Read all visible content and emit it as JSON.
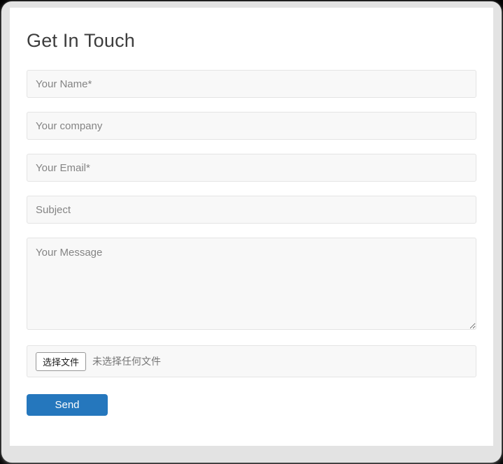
{
  "page": {
    "title": "Get In Touch"
  },
  "form": {
    "fields": [
      {
        "name": "name",
        "placeholder": "Your Name*",
        "value": ""
      },
      {
        "name": "company",
        "placeholder": "Your company",
        "value": ""
      },
      {
        "name": "email",
        "placeholder": "Your Email*",
        "value": ""
      },
      {
        "name": "subject",
        "placeholder": "Subject",
        "value": ""
      }
    ],
    "message": {
      "placeholder": "Your Message",
      "value": ""
    },
    "file_upload": {
      "button_label": "选择文件",
      "status_text": "未选择任何文件"
    },
    "send_label": "Send"
  },
  "colors": {
    "accent": "#2577bd",
    "card_background": "#ffffff",
    "window_background": "#e3e3e3",
    "field_background": "#f8f8f8",
    "field_border": "#e4e4e4",
    "placeholder_text": "#848484",
    "title_text": "#3d3d3d"
  }
}
